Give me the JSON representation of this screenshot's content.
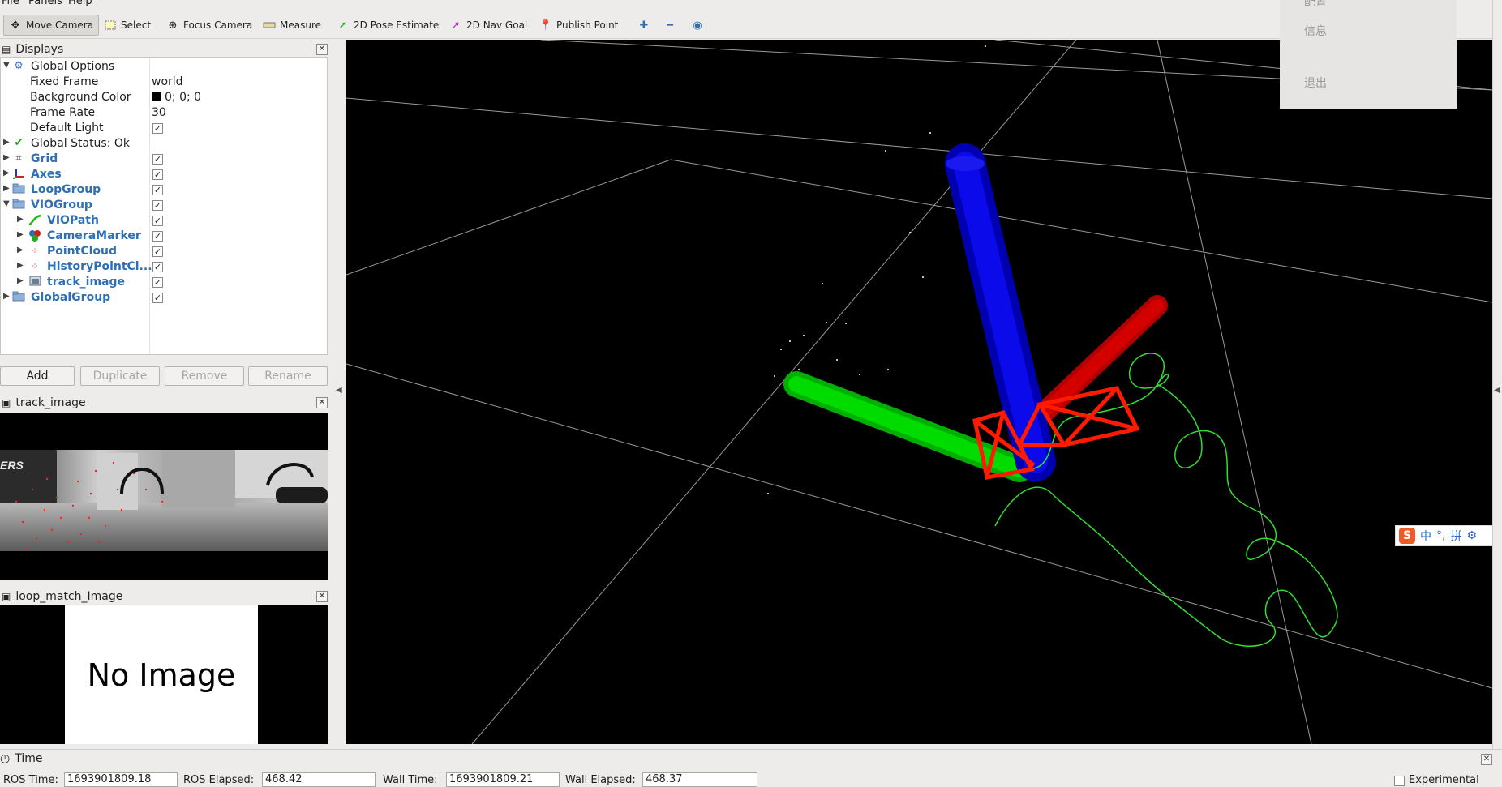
{
  "menu": [
    "File",
    "Panels",
    "Help"
  ],
  "toolbar": {
    "move_camera": "Move Camera",
    "select": "Select",
    "focus_camera": "Focus Camera",
    "measure": "Measure",
    "pose_estimate": "2D Pose Estimate",
    "nav_goal": "2D Nav Goal",
    "publish_point": "Publish Point"
  },
  "displays": {
    "title": "Displays",
    "rows": [
      {
        "name": "Global Options"
      },
      {
        "name": "Fixed Frame",
        "value": "world"
      },
      {
        "name": "Background Color",
        "value": "0; 0; 0"
      },
      {
        "name": "Frame Rate",
        "value": "30"
      },
      {
        "name": "Default Light"
      },
      {
        "name": "Global Status: Ok"
      },
      {
        "name": "Grid"
      },
      {
        "name": "Axes"
      },
      {
        "name": "LoopGroup"
      },
      {
        "name": "VIOGroup"
      },
      {
        "name": "VIOPath"
      },
      {
        "name": "CameraMarker"
      },
      {
        "name": "PointCloud"
      },
      {
        "name": "HistoryPointCl..."
      },
      {
        "name": "track_image"
      },
      {
        "name": "GlobalGroup"
      }
    ],
    "buttons": {
      "add": "Add",
      "duplicate": "Duplicate",
      "remove": "Remove",
      "rename": "Rename"
    }
  },
  "track_image": {
    "title": "track_image",
    "overlay_text": "ERS"
  },
  "loop_match": {
    "title": "loop_match_Image",
    "placeholder": "No Image"
  },
  "time": {
    "title": "Time",
    "ros_time_label": "ROS Time:",
    "ros_time": "1693901809.18",
    "ros_elapsed_label": "ROS Elapsed:",
    "ros_elapsed": "468.42",
    "wall_time_label": "Wall Time:",
    "wall_time": "1693901809.21",
    "wall_elapsed_label": "Wall Elapsed:",
    "wall_elapsed": "468.37",
    "experimental": "Experimental"
  },
  "popup_menu": [
    "配置",
    "信息",
    "退出"
  ],
  "ime_bar": {
    "lang": "中",
    "punct": "°,",
    "mode": "拼"
  },
  "colors": {
    "x_axis": "#c80000",
    "y_axis": "#00c800",
    "z_axis": "#0000d0",
    "path": "#33dd33",
    "camera_marker": "#ff1a00",
    "link_blue": "#2f6fb3"
  }
}
